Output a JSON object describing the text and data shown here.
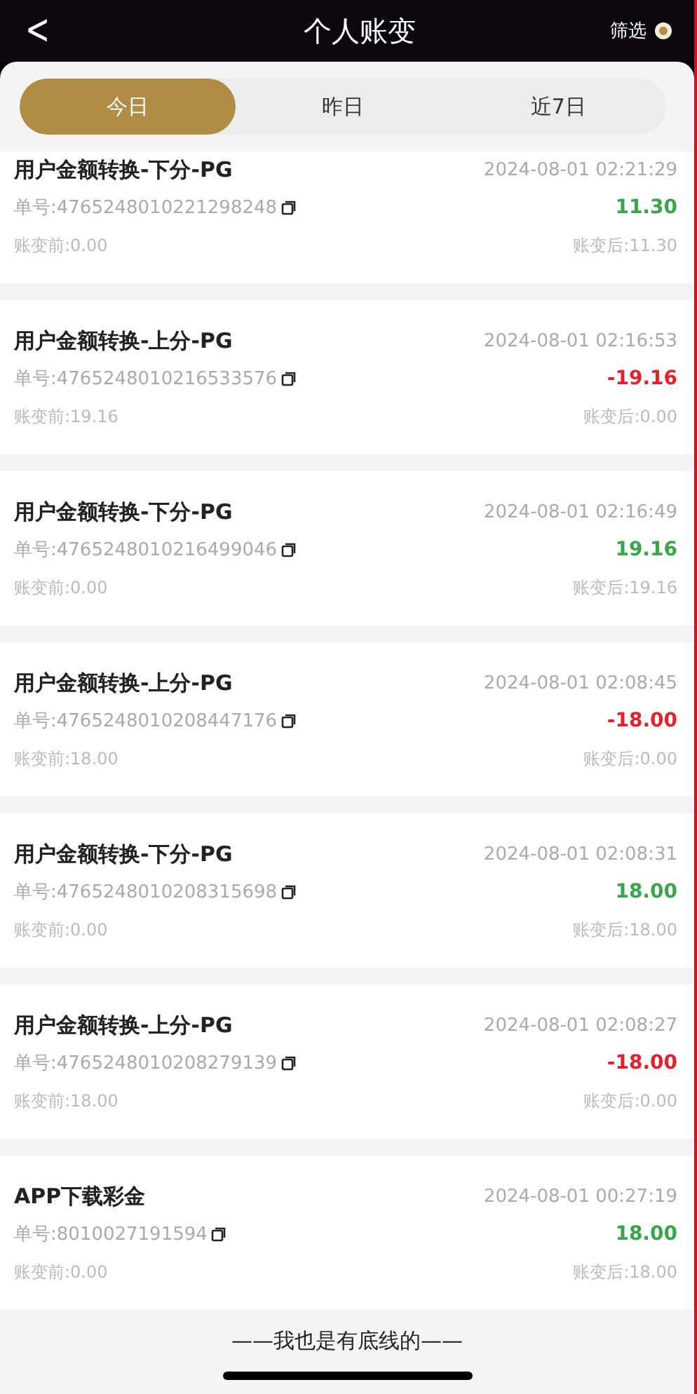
{
  "header": {
    "back": "<",
    "title": "个人账变",
    "filter": "筛选"
  },
  "tabs": [
    {
      "label": "今日",
      "selected": true
    },
    {
      "label": "昨日",
      "selected": false
    },
    {
      "label": "近7日",
      "selected": false
    }
  ],
  "records": [
    {
      "title": "用户金额转换-下分-PG",
      "time": "2024-08-01 02:21:29",
      "order": "单号:4765248010221298248",
      "amount": "11.30",
      "kind": "credit",
      "before": "账变前:0.00",
      "after": "账变后:11.30"
    },
    {
      "title": "用户金额转换-上分-PG",
      "time": "2024-08-01 02:16:53",
      "order": "单号:4765248010216533576",
      "amount": "-19.16",
      "kind": "debit",
      "before": "账变前:19.16",
      "after": "账变后:0.00"
    },
    {
      "title": "用户金额转换-下分-PG",
      "time": "2024-08-01 02:16:49",
      "order": "单号:4765248010216499046",
      "amount": "19.16",
      "kind": "credit",
      "before": "账变前:0.00",
      "after": "账变后:19.16"
    },
    {
      "title": "用户金额转换-上分-PG",
      "time": "2024-08-01 02:08:45",
      "order": "单号:4765248010208447176",
      "amount": "-18.00",
      "kind": "debit",
      "before": "账变前:18.00",
      "after": "账变后:0.00"
    },
    {
      "title": "用户金额转换-下分-PG",
      "time": "2024-08-01 02:08:31",
      "order": "单号:4765248010208315698",
      "amount": "18.00",
      "kind": "credit",
      "before": "账变前:0.00",
      "after": "账变后:18.00"
    },
    {
      "title": "用户金额转换-上分-PG",
      "time": "2024-08-01 02:08:27",
      "order": "单号:4765248010208279139",
      "amount": "-18.00",
      "kind": "debit",
      "before": "账变前:18.00",
      "after": "账变后:0.00"
    },
    {
      "title": "APP下载彩金",
      "time": "2024-08-01 00:27:19",
      "order": "单号:8010027191594",
      "amount": "18.00",
      "kind": "credit",
      "before": "账变前:0.00",
      "after": "账变后:18.00"
    }
  ],
  "footer": "——我也是有底线的——"
}
